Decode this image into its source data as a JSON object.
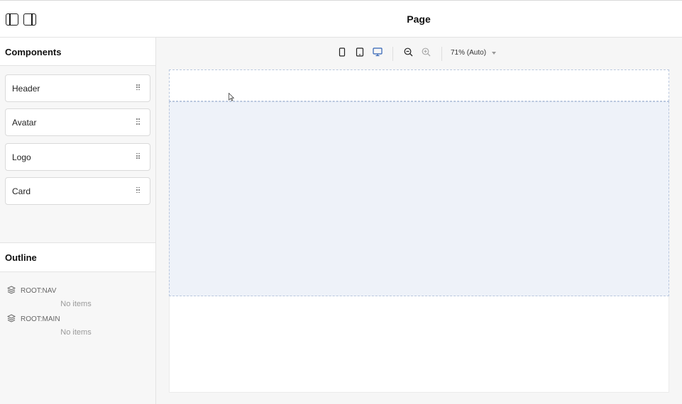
{
  "header": {
    "title": "Page",
    "left_sidebar_toggle_icon": "sidebar-left-icon",
    "right_sidebar_toggle_icon": "sidebar-right-icon"
  },
  "components": {
    "heading": "Components",
    "items": [
      {
        "label": "Header"
      },
      {
        "label": "Avatar"
      },
      {
        "label": "Logo"
      },
      {
        "label": "Card"
      }
    ],
    "drag_handle_icon": "grip-dots-icon"
  },
  "outline": {
    "heading": "Outline",
    "roots": [
      {
        "label": "ROOT:NAV",
        "empty_text": "No items"
      },
      {
        "label": "ROOT:MAIN",
        "empty_text": "No items"
      }
    ],
    "root_icon": "layers-icon"
  },
  "canvas_toolbar": {
    "viewports": [
      "mobile-icon",
      "tablet-icon",
      "desktop-icon"
    ],
    "active_viewport": "desktop",
    "zoom_label": "71% (Auto)",
    "zoom_out_icon": "zoom-out-icon",
    "zoom_in_icon": "zoom-in-icon"
  },
  "colors": {
    "accent": "#2f62b5",
    "drop_zone_fill": "#eef2f9",
    "drop_zone_border": "#b9c7de"
  }
}
